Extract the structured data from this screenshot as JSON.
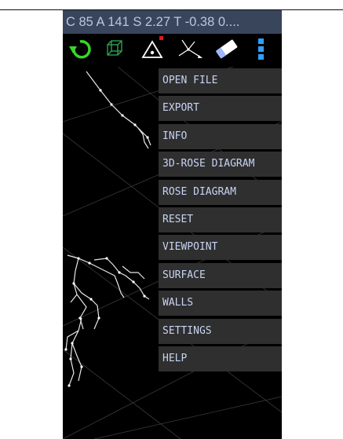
{
  "status_bar": {
    "text": "C 85 A 141 S 2.27 T -0.38 0...."
  },
  "toolbar": {
    "tools": [
      {
        "icon": "refresh-icon",
        "color": "#39d62a"
      },
      {
        "icon": "cube-icon",
        "color": "#2fa050"
      },
      {
        "icon": "triangle-icon",
        "color": "#ffffff",
        "badge_color": "#e3171b"
      },
      {
        "icon": "axes-icon",
        "color": "#ffffff"
      },
      {
        "icon": "eraser-icon",
        "color": "#ffffff"
      },
      {
        "icon": "overflow-menu-icon",
        "color": "#2ea0ff"
      }
    ]
  },
  "menu": {
    "items": [
      {
        "label": "OPEN FILE"
      },
      {
        "label": "EXPORT"
      },
      {
        "label": "INFO"
      },
      {
        "label": "3D-ROSE DIAGRAM"
      },
      {
        "label": "ROSE DIAGRAM"
      },
      {
        "label": "RESET"
      },
      {
        "label": "VIEWPOINT"
      },
      {
        "label": "SURFACE"
      },
      {
        "label": "WALLS"
      },
      {
        "label": "SETTINGS"
      },
      {
        "label": "HELP"
      }
    ]
  },
  "colors": {
    "title_bg": "#38455b",
    "title_text": "#b9c6e2",
    "menu_bg": "#2f2f2f",
    "menu_text": "#c7d4f4",
    "canvas_bg": "#000000"
  }
}
